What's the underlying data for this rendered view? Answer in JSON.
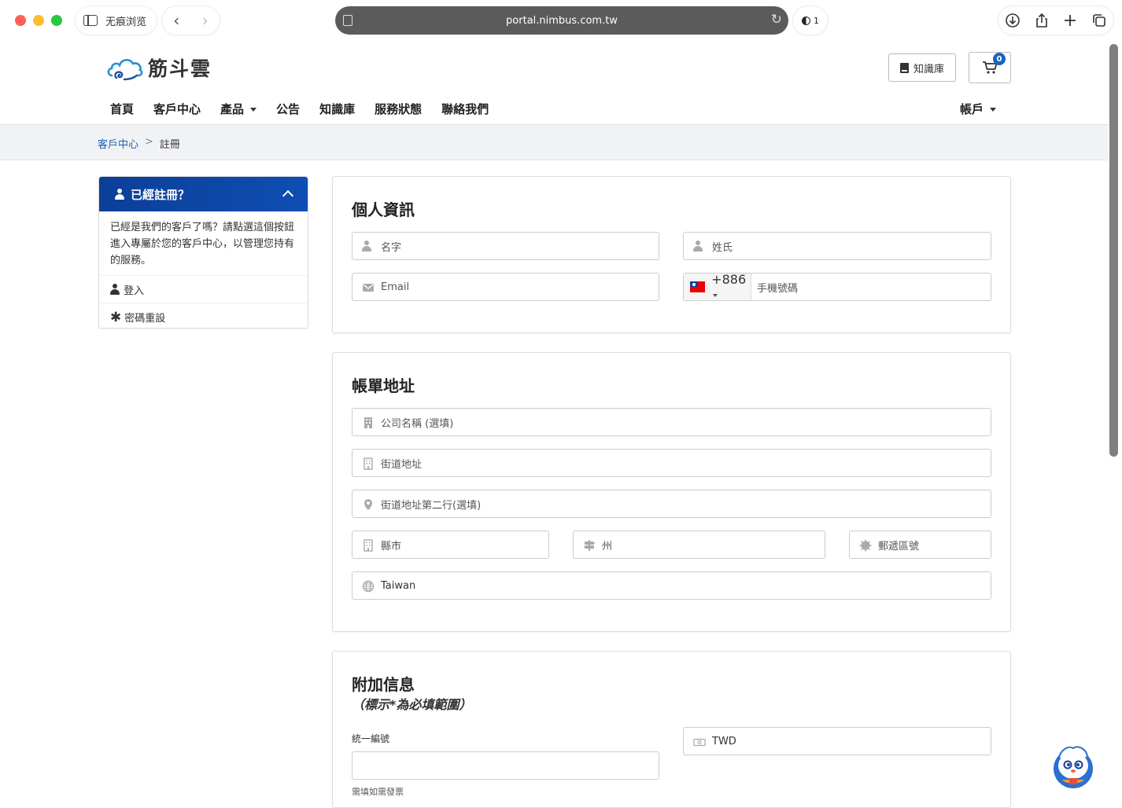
{
  "browser": {
    "sidebar_label": "无痕浏览",
    "url": "portal.nimbus.com.tw",
    "tracker_count": "1"
  },
  "header": {
    "logo_text": "筋斗雲",
    "kb_button": "知識庫",
    "cart_count": "0",
    "nav": [
      {
        "label": "首頁"
      },
      {
        "label": "客戶中心"
      },
      {
        "label": "產品"
      },
      {
        "label": "公告"
      },
      {
        "label": "知識庫"
      },
      {
        "label": "服務狀態"
      },
      {
        "label": "聯絡我們"
      }
    ],
    "account": "帳戶"
  },
  "breadcrumb": {
    "parent": "客戶中心",
    "separator": ">",
    "current": "註冊"
  },
  "sidebar": {
    "title": "已經註冊？",
    "body": "已經是我們的客戶了嗎？請點選這個按鈕進入專屬於您的客戶中心，以管理您持有的服務。",
    "login": "登入",
    "reset": "密碼重設"
  },
  "personal": {
    "title": "個人資訊",
    "first_name_ph": "名字",
    "last_name_ph": "姓氏",
    "email_ph": "Email",
    "phone_code": "+886",
    "phone_ph": "手機號碼"
  },
  "billing": {
    "title": "帳單地址",
    "company_ph": "公司名稱 (選填)",
    "street_ph": "街道地址",
    "street2_ph": "街道地址第二行(選填)",
    "city_ph": "縣市",
    "state_ph": "州",
    "postcode_ph": "郵遞區號",
    "country": "Taiwan"
  },
  "additional": {
    "title": "附加信息",
    "subtitle": "（標示*為必填範圍）",
    "tax_label": "統一編號",
    "tax_help": "需填如需發票",
    "currency": "TWD"
  },
  "colors": {
    "accent": "#0f4eb3",
    "link": "#1b5db8",
    "badge": "#1565c0"
  }
}
